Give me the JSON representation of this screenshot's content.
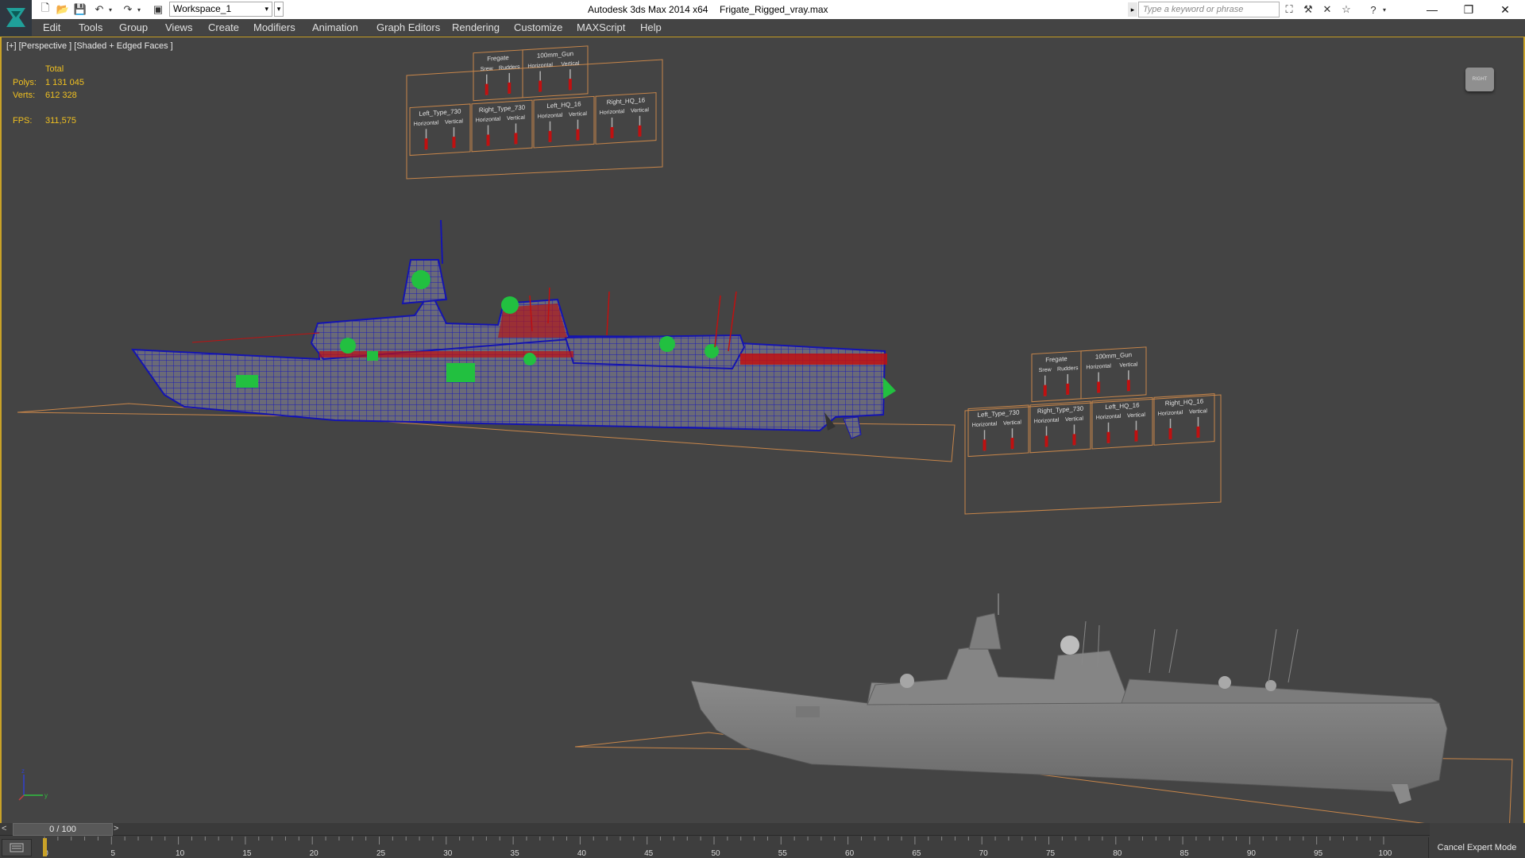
{
  "titlebar": {
    "workspace": "Workspace_1",
    "app_title": "Autodesk 3ds Max  2014 x64",
    "file_name": "Frigate_Rigged_vray.max",
    "search_placeholder": "Type a keyword or phrase"
  },
  "menu": [
    "Edit",
    "Tools",
    "Group",
    "Views",
    "Create",
    "Modifiers",
    "Animation",
    "Graph Editors",
    "Rendering",
    "Customize",
    "MAXScript",
    "Help"
  ],
  "viewport": {
    "label": "[+] [Perspective ] [Shaded + Edged Faces ]",
    "stats": {
      "total_label": "Total",
      "polys_label": "Polys:",
      "polys_value": "1 131 045",
      "verts_label": "Verts:",
      "verts_value": "612 328",
      "fps_label": "FPS:",
      "fps_value": "311,575"
    },
    "rig_panel": {
      "top_groups": [
        {
          "title": "Fregate",
          "sliders": [
            "Srew",
            "Rudders"
          ]
        },
        {
          "title": "100mm_Gun",
          "sliders": [
            "Horizontal",
            "Vertical"
          ]
        }
      ],
      "bottom_groups": [
        {
          "title": "Left_Type_730",
          "sliders": [
            "Horizontal",
            "Vertical"
          ]
        },
        {
          "title": "Right_Type_730",
          "sliders": [
            "Horizontal",
            "Vertical"
          ]
        },
        {
          "title": "Left_HQ_16",
          "sliders": [
            "Horizontal",
            "Vertical"
          ]
        },
        {
          "title": "Right_HQ_16",
          "sliders": [
            "Horizontal",
            "Vertical"
          ]
        }
      ]
    },
    "viewcube_label": "RIGHT"
  },
  "timeline": {
    "frame_display": "0 / 100",
    "ticks": [
      "0",
      "5",
      "10",
      "15",
      "20",
      "25",
      "30",
      "35",
      "40",
      "45",
      "50",
      "55",
      "60",
      "65",
      "70",
      "75",
      "80",
      "85",
      "90",
      "95",
      "100"
    ],
    "cancel_expert": "Cancel Expert Mode"
  },
  "colors": {
    "background": "#444444",
    "accent": "#c9a228",
    "stat_text": "#f0c020",
    "wire_blue": "#2020c0",
    "wire_red": "#c01010",
    "helper_green": "#22c040",
    "rig_orange": "#c8864a"
  }
}
